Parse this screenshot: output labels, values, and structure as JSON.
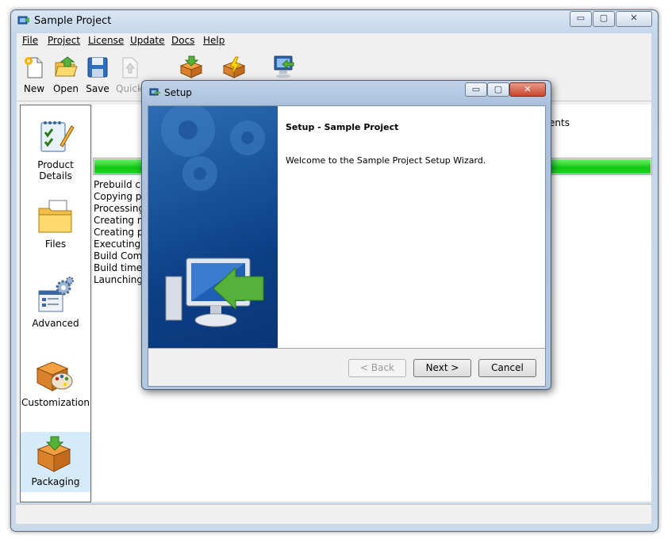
{
  "window": {
    "title": "Sample Project",
    "caption_buttons": {
      "minimize": "▭",
      "maximize": "▢",
      "close": "✕"
    }
  },
  "menu": [
    "File",
    "Project",
    "License",
    "Update",
    "Docs",
    "Help"
  ],
  "toolbar": {
    "items": [
      {
        "label": "New",
        "icon": "new-document-icon"
      },
      {
        "label": "Open",
        "icon": "open-folder-icon"
      },
      {
        "label": "Save",
        "icon": "save-disk-icon"
      },
      {
        "label": "Quick",
        "icon": "quick-build-icon"
      },
      {
        "label": "",
        "icon": "build-package-icon"
      },
      {
        "label": "",
        "icon": "build-run-icon"
      },
      {
        "label": "",
        "icon": "run-setup-icon"
      }
    ]
  },
  "nav": {
    "items": [
      {
        "label": "Product Details",
        "icon": "product-details-icon",
        "active": false
      },
      {
        "label": "Files",
        "icon": "files-icon",
        "active": false
      },
      {
        "label": "Advanced",
        "icon": "advanced-gears-icon",
        "active": false
      },
      {
        "label": "Customization",
        "icon": "customization-palette-icon",
        "active": false
      },
      {
        "label": "Packaging",
        "icon": "packaging-box-icon",
        "active": true
      }
    ]
  },
  "build": {
    "progress": 1.0,
    "progress_color": "#16cc16",
    "peek_text": "ents",
    "log": [
      "Prebuild ch",
      "Copying pr",
      "Processing",
      "Creating m",
      "Creating pr",
      "Executing p",
      "Build Comp",
      "Build time:",
      "Launching"
    ]
  },
  "dialog": {
    "title": "Setup",
    "heading": "Setup - Sample Project",
    "welcome": "Welcome to the Sample Project Setup Wizard.",
    "buttons": {
      "back": "< Back",
      "next": "Next >",
      "cancel": "Cancel"
    },
    "side_color": "#0c3f86"
  }
}
